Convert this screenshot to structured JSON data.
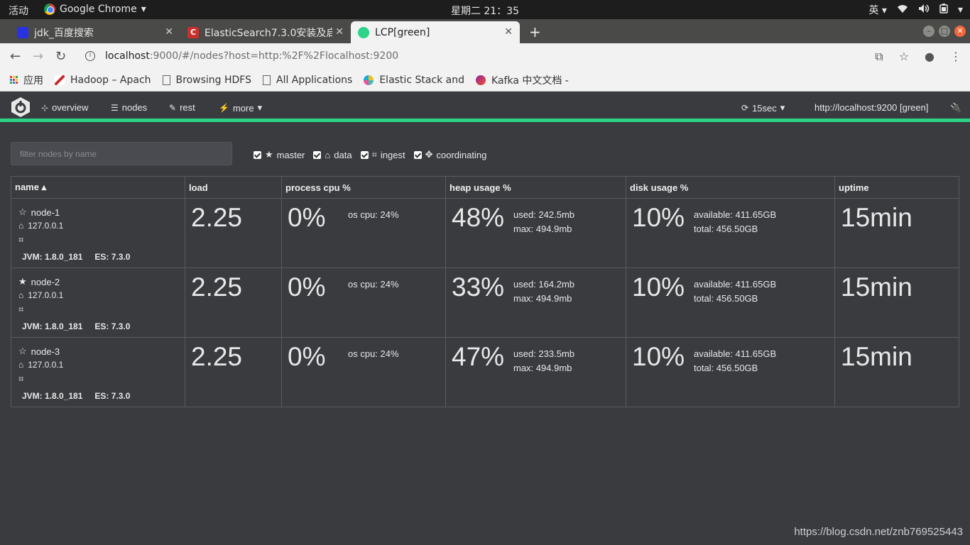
{
  "os": {
    "activities": "活动",
    "app_name": "Google Chrome",
    "clock": "星期二 21：35",
    "input_method": "英"
  },
  "browser": {
    "tabs": [
      {
        "title": "jdk_百度搜索"
      },
      {
        "title": "ElasticSearch7.3.0安装及启"
      },
      {
        "title": "LCP[green]"
      }
    ],
    "url_host": "localhost",
    "url_rest": ":9000/#/nodes?host=http:%2F%2Flocalhost:9200",
    "bookmarks": [
      {
        "label": "应用"
      },
      {
        "label": "Hadoop – Apach"
      },
      {
        "label": "Browsing HDFS"
      },
      {
        "label": "All Applications"
      },
      {
        "label": "Elastic Stack and"
      },
      {
        "label": "Kafka 中文文档 -"
      }
    ]
  },
  "app": {
    "nav": {
      "overview": "overview",
      "nodes": "nodes",
      "rest": "rest",
      "more": "more",
      "refresh": "15sec",
      "cluster": "http://localhost:9200 [green]"
    },
    "accent_color": "#2bd486",
    "filter_placeholder": "filter nodes by name",
    "filters": {
      "master": "master",
      "data": "data",
      "ingest": "ingest",
      "coordinating": "coordinating"
    },
    "columns": {
      "name": "name",
      "load": "load",
      "cpu": "process cpu %",
      "heap": "heap usage %",
      "disk": "disk usage %",
      "uptime": "uptime"
    },
    "nodes": [
      {
        "name": "node-1",
        "master": false,
        "ip": "127.0.0.1",
        "jvm": "JVM: 1.8.0_181",
        "es": "ES: 7.3.0",
        "load": "2.25",
        "cpu": "0%",
        "os_cpu": "os cpu: 24%",
        "heap": "48%",
        "heap_used": "used: 242.5mb",
        "heap_max": "max: 494.9mb",
        "disk": "10%",
        "disk_avail": "available: 411.65GB",
        "disk_total": "total: 456.50GB",
        "uptime": "15min"
      },
      {
        "name": "node-2",
        "master": true,
        "ip": "127.0.0.1",
        "jvm": "JVM: 1.8.0_181",
        "es": "ES: 7.3.0",
        "load": "2.25",
        "cpu": "0%",
        "os_cpu": "os cpu: 24%",
        "heap": "33%",
        "heap_used": "used: 164.2mb",
        "heap_max": "max: 494.9mb",
        "disk": "10%",
        "disk_avail": "available: 411.65GB",
        "disk_total": "total: 456.50GB",
        "uptime": "15min"
      },
      {
        "name": "node-3",
        "master": false,
        "ip": "127.0.0.1",
        "jvm": "JVM: 1.8.0_181",
        "es": "ES: 7.3.0",
        "load": "2.25",
        "cpu": "0%",
        "os_cpu": "os cpu: 24%",
        "heap": "47%",
        "heap_used": "used: 233.5mb",
        "heap_max": "max: 494.9mb",
        "disk": "10%",
        "disk_avail": "available: 411.65GB",
        "disk_total": "total: 456.50GB",
        "uptime": "15min"
      }
    ]
  },
  "watermark": "https://blog.csdn.net/znb769525443"
}
